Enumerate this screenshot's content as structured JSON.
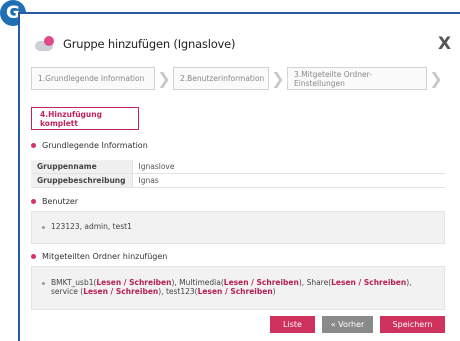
{
  "marker": {
    "letter": "G"
  },
  "dialog": {
    "title": "Gruppe hinzufügen  (Ignaslove)",
    "close_symbol": "X"
  },
  "steps": [
    {
      "label": "1.Grundlegende Information"
    },
    {
      "label": "2.Benutzerinformation"
    },
    {
      "label": "3.Mitgeteilte Ordner-Einstellungen"
    },
    {
      "label": "4.Hinzufügung komplett"
    }
  ],
  "sections": {
    "basic": "Grundlegende Information",
    "users": "Benutzer",
    "folders": "Mitgeteilten Ordner hinzufügen"
  },
  "info": {
    "rows": [
      {
        "key": "Gruppenname",
        "value": "Ignaslove"
      },
      {
        "key": "Gruppebeschreibung",
        "value": "Ignas"
      }
    ]
  },
  "users_text": "123123, admin, test1",
  "folders": {
    "items": [
      {
        "name": "BMKT_usb1(",
        "perm": "Lesen / Schreiben",
        "close": "), "
      },
      {
        "name": "Multimedia(",
        "perm": "Lesen / Schreiben",
        "close": "), "
      },
      {
        "name": "Share(",
        "perm": "Lesen / Schreiben",
        "close": "), "
      },
      {
        "name": "service (",
        "perm": "Lesen / Schreiben",
        "close": "), "
      },
      {
        "name": "test123(",
        "perm": "Lesen / Schreiben",
        "close": ")"
      }
    ]
  },
  "buttons": {
    "list": "Liste",
    "prev": "« Vorher",
    "save": "Speichern"
  },
  "colors": {
    "accent": "#d0325e",
    "frame": "#2a5aa6",
    "marker": "#1f6fb3"
  },
  "icons": {
    "title": "group-add-icon",
    "close": "close-icon",
    "step_separator": "chevron-right-icon"
  }
}
